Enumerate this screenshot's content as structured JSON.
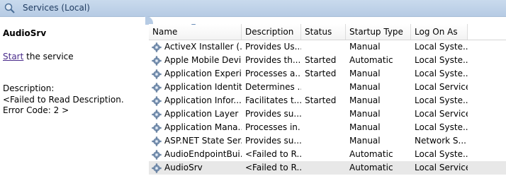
{
  "window": {
    "title": "Services (Local)"
  },
  "left_panel": {
    "service_name": "AudioSrv",
    "start_link": "Start",
    "start_suffix": " the service",
    "description_label": "Description:",
    "description_text": "<Failed to Read Description. Error Code: 2 >"
  },
  "columns": [
    "Name",
    "Description",
    "Status",
    "Startup Type",
    "Log On As"
  ],
  "sorted_column": "Name",
  "services": [
    {
      "name": "ActiveX Installer (...",
      "description": "Provides Us...",
      "status": "",
      "startup": "Manual",
      "logon": "Local Syste..."
    },
    {
      "name": "Apple Mobile Devi...",
      "description": "Provides th...",
      "status": "Started",
      "startup": "Automatic",
      "logon": "Local Syste..."
    },
    {
      "name": "Application Experi...",
      "description": "Processes a...",
      "status": "Started",
      "startup": "Manual",
      "logon": "Local Syste..."
    },
    {
      "name": "Application Identity",
      "description": "Determines ...",
      "status": "",
      "startup": "Manual",
      "logon": "Local Service"
    },
    {
      "name": "Application Infor...",
      "description": "Facilitates t...",
      "status": "Started",
      "startup": "Manual",
      "logon": "Local Syste..."
    },
    {
      "name": "Application Layer ...",
      "description": "Provides su...",
      "status": "",
      "startup": "Manual",
      "logon": "Local Service"
    },
    {
      "name": "Application Mana...",
      "description": "Processes in...",
      "status": "",
      "startup": "Manual",
      "logon": "Local Syste..."
    },
    {
      "name": "ASP.NET State Ser...",
      "description": "Provides su...",
      "status": "",
      "startup": "Manual",
      "logon": "Network S..."
    },
    {
      "name": "AudioEndpointBui...",
      "description": "<Failed to R...",
      "status": "",
      "startup": "Automatic",
      "logon": "Local Syste..."
    },
    {
      "name": "AudioSrv",
      "description": "<Failed to R...",
      "status": "",
      "startup": "Automatic",
      "logon": "Local Service",
      "selected": true
    }
  ],
  "icons": {
    "title": "magnifier-services-icon",
    "row": "gear-icon"
  },
  "colors": {
    "titlebar": "#b6cbe4",
    "link": "#4b2c8c",
    "selected_row": "#e8e8e8"
  }
}
